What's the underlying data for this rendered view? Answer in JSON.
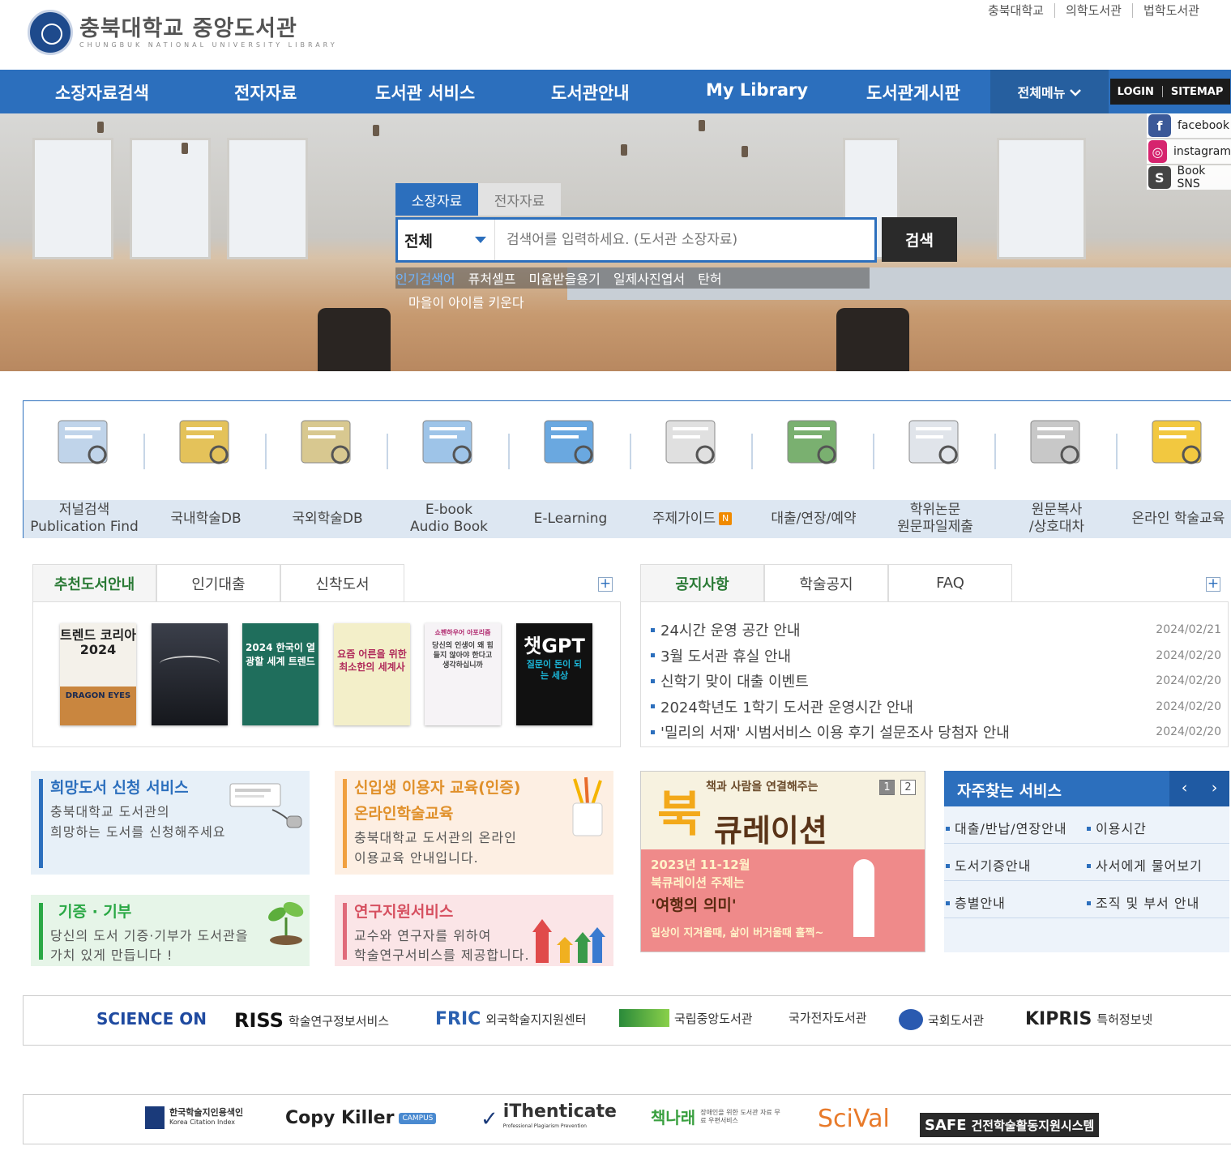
{
  "header": {
    "logo_ko": "충북대학교 중앙도서관",
    "logo_en": "CHUNGBUK NATIONAL UNIVERSITY LIBRARY",
    "top_links": [
      "충북대학교",
      "의학도서관",
      "법학도서관"
    ]
  },
  "nav": {
    "items": [
      "소장자료검색",
      "전자자료",
      "도서관 서비스",
      "도서관안내",
      "My Library",
      "도서관게시판"
    ],
    "all_menu": "전체메뉴",
    "login": "LOGIN",
    "sitemap": "SITEMAP"
  },
  "sns": [
    "facebook",
    "instagram",
    "Book SNS"
  ],
  "search": {
    "tabs": [
      "소장자료",
      "전자자료"
    ],
    "scope": "전체",
    "placeholder": "검색어를 입력하세요. (도서관 소장자료)",
    "button": "검색",
    "popular_label": "인기검색어",
    "popular": [
      "퓨처셀프",
      "미움받을용기",
      "일제사진엽서",
      "탄허"
    ],
    "popular_extra": "마을이 아이를 키운다"
  },
  "quick": [
    {
      "line1": "저널검색",
      "line2": "Publication Find",
      "icon": "magnifier-chart-icon"
    },
    {
      "line1": "국내학술DB",
      "line2": "",
      "icon": "open-book-icon"
    },
    {
      "line1": "국외학술DB",
      "line2": "",
      "icon": "world-map-icon"
    },
    {
      "line1": "E-book",
      "line2": "Audio Book",
      "icon": "computer-monitor-icon"
    },
    {
      "line1": "E-Learning",
      "line2": "",
      "icon": "browser-ie-icon"
    },
    {
      "line1": "주제가이드",
      "line2": "",
      "icon": "checklist-notepad-icon",
      "badge": "N"
    },
    {
      "line1": "대출/연장/예약",
      "line2": "",
      "icon": "book-stack-icon"
    },
    {
      "line1": "학위논문",
      "line2": "원문파일제출",
      "icon": "paper-quill-icon"
    },
    {
      "line1": "원문복사",
      "line2": "/상호대차",
      "icon": "notebook-pen-icon"
    },
    {
      "line1": "온라인 학술교육",
      "line2": "",
      "icon": "folder-search-icon"
    }
  ],
  "books_panel": {
    "tabs": [
      "추천도서안내",
      "인기대출",
      "신착도서"
    ],
    "books": [
      {
        "title": "트렌드 코리아 2024",
        "sub": "DRAGON EYES"
      },
      {
        "title": "",
        "sub": ""
      },
      {
        "title": "2024 한국이 열광할 세계 트렌드",
        "sub": ""
      },
      {
        "title": "요즘 어른을 위한 최소한의 세계사",
        "sub": ""
      },
      {
        "title": "당신의 인생이 왜 힘들지 않아야 한다고 생각하십니까",
        "sub": "쇼펜하우어 아포리즘"
      },
      {
        "title": "챗GPT",
        "sub": "질문이 돈이 되는 세상"
      }
    ]
  },
  "notice_panel": {
    "tabs": [
      "공지사항",
      "학술공지",
      "FAQ"
    ],
    "items": [
      {
        "title": "24시간 운영 공간 안내",
        "date": "2024/02/21"
      },
      {
        "title": "3월 도서관 휴실 안내",
        "date": "2024/02/20"
      },
      {
        "title": "신학기 맞이 대출 이벤트",
        "date": "2024/02/20"
      },
      {
        "title": "2024학년도 1학기 도서관 운영시간 안내",
        "date": "2024/02/20"
      },
      {
        "title": "'밀리의 서재' 시범서비스 이용 후기 설문조사 당첨자 안내",
        "date": "2024/02/20"
      }
    ]
  },
  "services": {
    "hope": {
      "title": "희망도서 신청 서비스",
      "desc1": "충북대학교 도서관의",
      "desc2": "희망하는 도서를 신청해주세요"
    },
    "freshman": {
      "title": "신입생 이용자 교육(인증)",
      "title2": "온라인학술교육",
      "desc1": "충북대학교 도서관의 온라인",
      "desc2": "이용교육 안내입니다."
    },
    "donation": {
      "title": "기증 · 기부",
      "desc1": "당신의 도서 기증·기부가 도서관을",
      "desc2": "가치 있게 만듭니다 !"
    },
    "research": {
      "title": "연구지원서비스",
      "desc1": "교수와 연구자를 위하여",
      "desc2": "학술연구서비스를 제공합니다."
    }
  },
  "banner": {
    "tagline": "책과 사람을 연결해주는",
    "title_a": "북",
    "title_b": "큐레이션",
    "pages": [
      "1",
      "2"
    ],
    "line1": "2023년 11-12월",
    "line2": "북큐레이션 주제는",
    "line3": "'여행의 의미'",
    "line4": "일상이 지겨울때, 삶이 버거울때 훌쩍~"
  },
  "frequent": {
    "title": "자주찾는 서비스",
    "prev": "‹",
    "next": "›",
    "items": [
      "대출/반납/연장안내",
      "이용시간",
      "도서기증안내",
      "사서에게 물어보기",
      "층별안내",
      "조직 및 부서 안내"
    ]
  },
  "links_row1": [
    {
      "name": "SCIENCE ON",
      "text": ""
    },
    {
      "name": "RISS",
      "text": "학술연구정보서비스"
    },
    {
      "name": "FRIC",
      "text": "외국학술지지원센터"
    },
    {
      "name": "",
      "text": "국립중앙도서관"
    },
    {
      "name": "",
      "text": "국가전자도서관"
    },
    {
      "name": "",
      "text": "국회도서관"
    },
    {
      "name": "KIPRIS",
      "text": "특허정보넷"
    }
  ],
  "links_row2": [
    {
      "name": "한국학술지인용색인",
      "text": "Korea Citation Index"
    },
    {
      "name": "Copy Killer",
      "text": "CAMPUS"
    },
    {
      "name": "iThenticate",
      "text": "Professional Plagiarism Prevention"
    },
    {
      "name": "책나래",
      "text": "장애인을 위한 도서관 자료 무료 우편서비스"
    },
    {
      "name": "SciVal",
      "text": ""
    },
    {
      "name": "SAFE",
      "text": "건전학술활동지원시스템"
    }
  ]
}
